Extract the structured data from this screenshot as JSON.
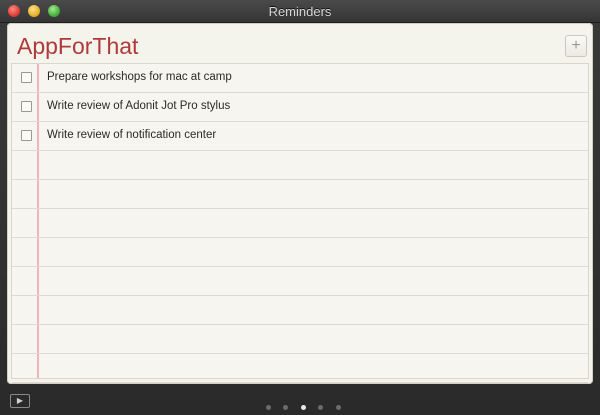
{
  "window": {
    "title": "Reminders"
  },
  "list": {
    "title": "AppForThat",
    "add_button_symbol": "+",
    "items": [
      {
        "label": "Prepare workshops for mac at camp",
        "checked": false
      },
      {
        "label": "Write review of Adonit Jot Pro stylus",
        "checked": false
      },
      {
        "label": "Write review of notification center",
        "checked": false
      }
    ]
  },
  "pager": {
    "pages": 5,
    "current_page": 3
  },
  "icons": {
    "close": "close-traffic-light",
    "minimize": "minimize-traffic-light",
    "zoom": "zoom-traffic-light",
    "show_hide": "sidebar-toggle-icon"
  },
  "colors": {
    "title_accent": "#b03a3a",
    "margin_line": "#f1b3bb",
    "paper": "#f4f3ec"
  }
}
